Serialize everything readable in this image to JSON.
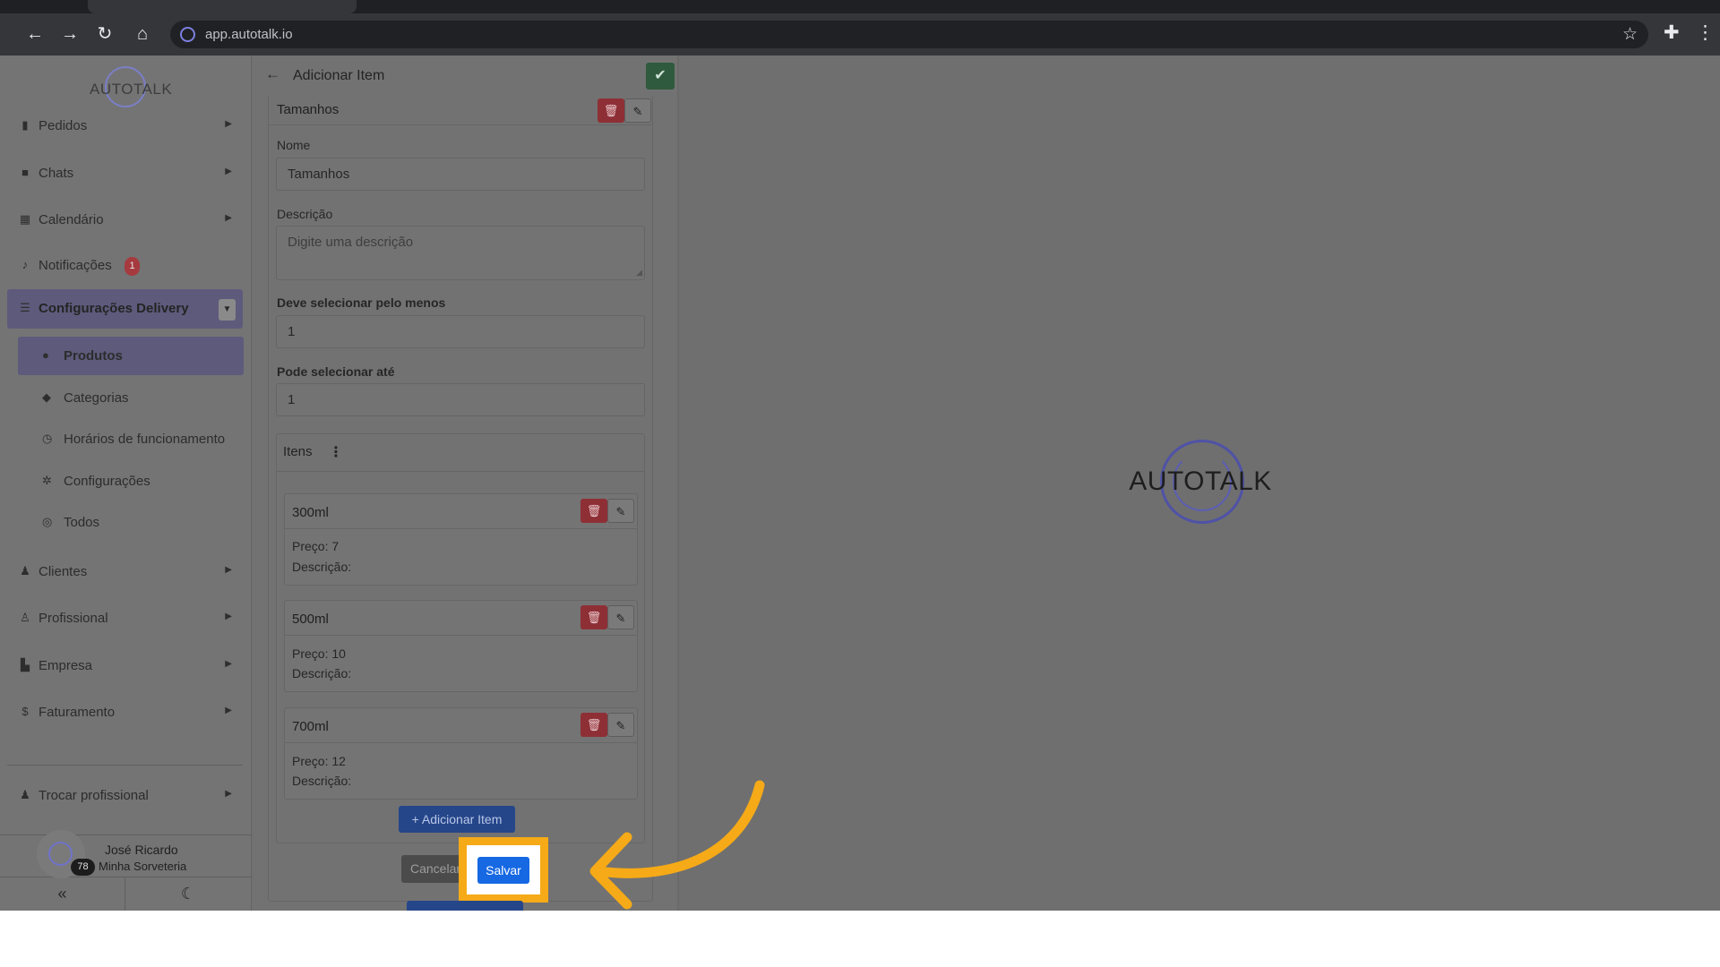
{
  "browser": {
    "url": "app.autotalk.io"
  },
  "sidebar": {
    "logo": "AUTOTALK",
    "items": [
      {
        "label": "Pedidos",
        "icon": "clipboard-icon"
      },
      {
        "label": "Chats",
        "icon": "chat-icon"
      },
      {
        "label": "Calendário",
        "icon": "calendar-icon"
      },
      {
        "label": "Notificações",
        "icon": "bell-icon",
        "badge": "1"
      },
      {
        "label": "Configurações Delivery",
        "icon": "sliders-icon",
        "expanded": true
      }
    ],
    "subitems": [
      {
        "label": "Produtos",
        "icon": "product-icon",
        "active": true
      },
      {
        "label": "Categorias",
        "icon": "tag-icon"
      },
      {
        "label": "Horários de funcionamento",
        "icon": "clock-icon"
      },
      {
        "label": "Configurações",
        "icon": "gear-icon"
      },
      {
        "label": "Todos",
        "icon": "globe-icon"
      }
    ],
    "items2": [
      {
        "label": "Clientes",
        "icon": "users-icon"
      },
      {
        "label": "Profissional",
        "icon": "user-cog-icon"
      },
      {
        "label": "Empresa",
        "icon": "building-icon"
      },
      {
        "label": "Faturamento",
        "icon": "dollar-icon"
      }
    ],
    "switch_professional": "Trocar profissional",
    "user": {
      "name": "José Ricardo",
      "org": "Minha Sorveteria",
      "count": "78"
    }
  },
  "panel": {
    "title": "Adicionar Item",
    "group_title": "Tamanhos",
    "name_label": "Nome",
    "name_value": "Tamanhos",
    "desc_label": "Descrição",
    "desc_placeholder": "Digite uma descrição",
    "min_label": "Deve selecionar pelo menos",
    "min_value": "1",
    "max_label": "Pode selecionar até",
    "max_value": "1",
    "itens_title": "Itens",
    "items": [
      {
        "name": "300ml",
        "price": "Preço: 7",
        "desc": "Descrição:"
      },
      {
        "name": "500ml",
        "price": "Preço: 10",
        "desc": "Descrição:"
      },
      {
        "name": "700ml",
        "price": "Preço: 12",
        "desc": "Descrição:"
      }
    ],
    "add_item_label": "+ Adicionar Item",
    "cancel_label": "Cancelar",
    "save_label": "Salvar"
  },
  "preview": {
    "logo": "AUTOTALK"
  },
  "colors": {
    "highlight": "#f6aa17",
    "save": "#1668e3",
    "delete": "#8e2f36"
  }
}
